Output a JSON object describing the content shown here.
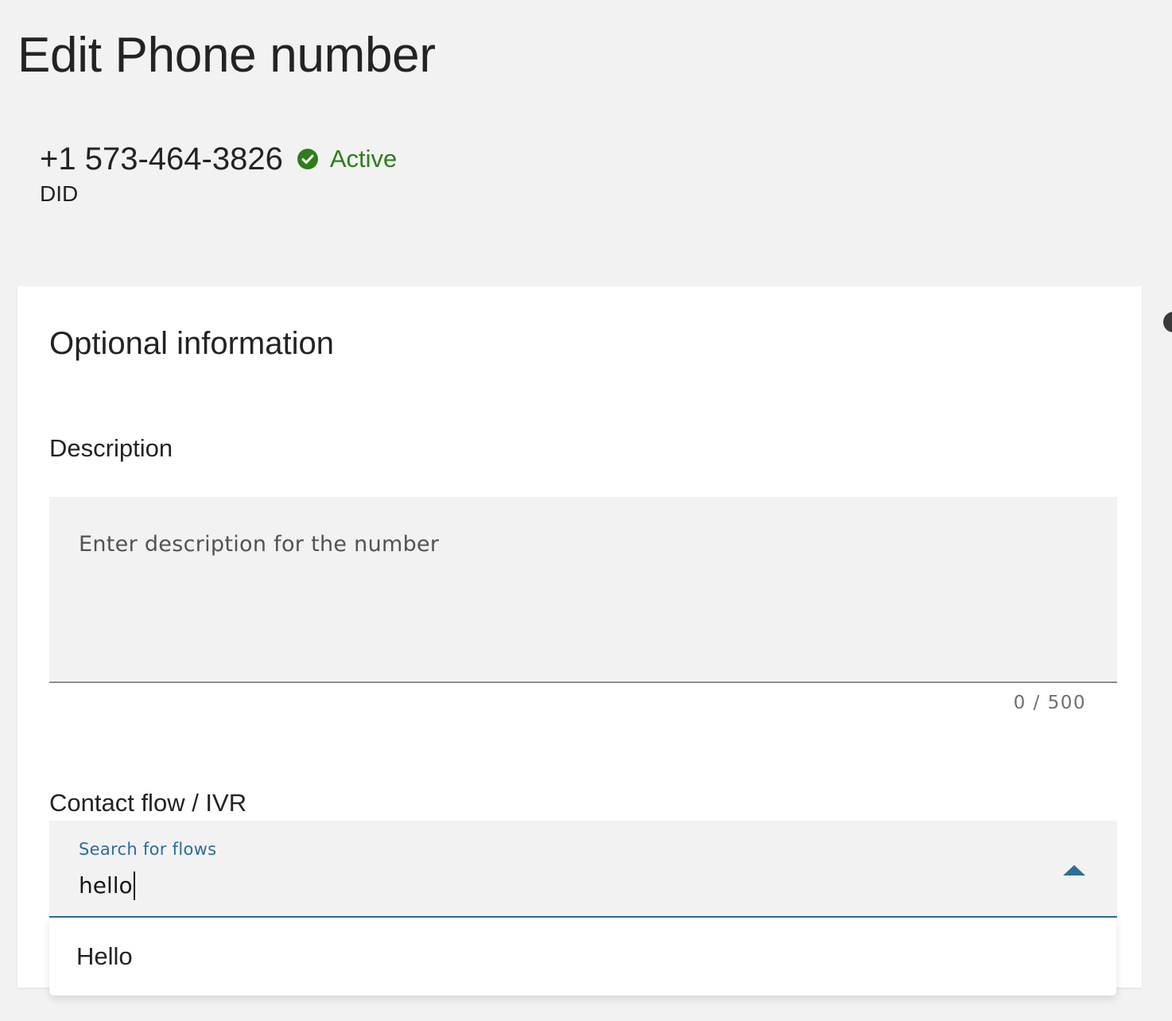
{
  "page": {
    "title": "Edit Phone number"
  },
  "number": {
    "phone": "+1 573-464-3826",
    "status": "Active",
    "status_icon": "check-circle-icon",
    "type": "DID",
    "status_color": "#2e7d1a"
  },
  "optional_info": {
    "title": "Optional information",
    "description": {
      "label": "Description",
      "placeholder": "Enter description for the number",
      "value": "",
      "counter": "0 / 500"
    },
    "contact_flow": {
      "label": "Contact flow / IVR",
      "search_label": "Search for flows",
      "value": "hello",
      "toggle_icon": "caret-up-icon",
      "options": [
        {
          "label": "Hello"
        }
      ]
    }
  },
  "colors": {
    "accent": "#2b6e96",
    "background": "#f2f2f2"
  }
}
